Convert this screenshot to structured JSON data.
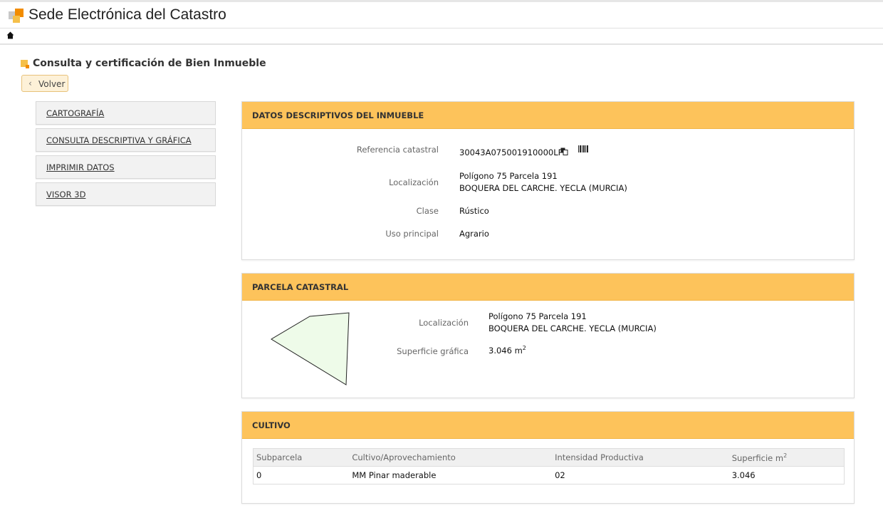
{
  "app": {
    "title": "Sede Electrónica del Catastro"
  },
  "page": {
    "title": "Consulta y certificación de Bien Inmueble",
    "back_label": "Volver"
  },
  "side_menu": [
    {
      "label": "CARTOGRAFÍA"
    },
    {
      "label": "CONSULTA DESCRIPTIVA Y GRÁFICA"
    },
    {
      "label": "IMPRIMIR DATOS"
    },
    {
      "label": "VISOR 3D"
    }
  ],
  "datos": {
    "title": "DATOS DESCRIPTIVOS DEL INMUEBLE",
    "ref_label": "Referencia catastral",
    "ref_value": "30043A075001910000LP",
    "loc_label": "Localización",
    "loc_line1": "Polígono 75 Parcela 191",
    "loc_line2": "BOQUERA DEL CARCHE. YECLA (MURCIA)",
    "clase_label": "Clase",
    "clase_value": "Rústico",
    "uso_label": "Uso principal",
    "uso_value": "Agrario"
  },
  "parcela": {
    "title": "PARCELA CATASTRAL",
    "loc_label": "Localización",
    "loc_line1": "Polígono 75 Parcela 191",
    "loc_line2": "BOQUERA DEL CARCHE. YECLA (MURCIA)",
    "sup_label": "Superficie gráfica",
    "sup_value": "3.046 m",
    "sup_unit_sup": "2",
    "shape_fill": "#eefbe9"
  },
  "cultivo": {
    "title": "CULTIVO",
    "headers": [
      "Subparcela",
      "Cultivo/Aprovechamiento",
      "Intensidad Productiva",
      "Superficie m"
    ],
    "header_sup": "2",
    "rows": [
      [
        "0",
        "MM Pinar maderable",
        "02",
        "3.046"
      ]
    ]
  },
  "colors": {
    "panel_header": "#fdc35b",
    "accent_orange": "#f28c00",
    "accent_yellow": "#f5c04a"
  }
}
